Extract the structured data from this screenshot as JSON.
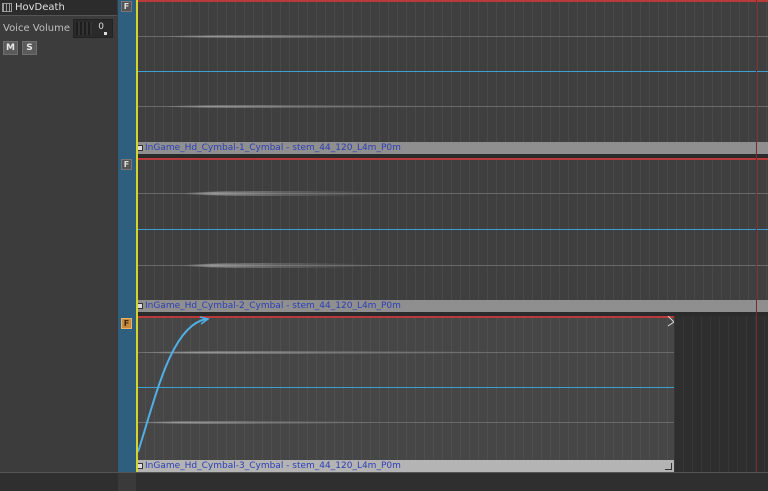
{
  "track": {
    "title": "HovDeath",
    "volume_label": "Voice Volume",
    "volume_value": "0",
    "mute_label": "M",
    "solo_label": "S"
  },
  "clips": [
    {
      "flag": "F",
      "name": "InGame_Hd_Cymbal-1_Cymbal - stem_44_120_L4m_P0m"
    },
    {
      "flag": "F",
      "name": "InGame_Hd_Cymbal-2_Cymbal - stem_44_120_L4m_P0m"
    },
    {
      "flag": "F",
      "name": "InGame_Hd_Cymbal-3_Cymbal - stem_44_120_L4m_P0m"
    }
  ],
  "colors": {
    "accent_blue": "#3e9fd3",
    "playhead": "#d6d32a",
    "clip_top": "#b83a3a",
    "clip_name": "#2d3eb5"
  },
  "icons": [
    "grip-icon",
    "volume-knob",
    "fade-curve"
  ]
}
